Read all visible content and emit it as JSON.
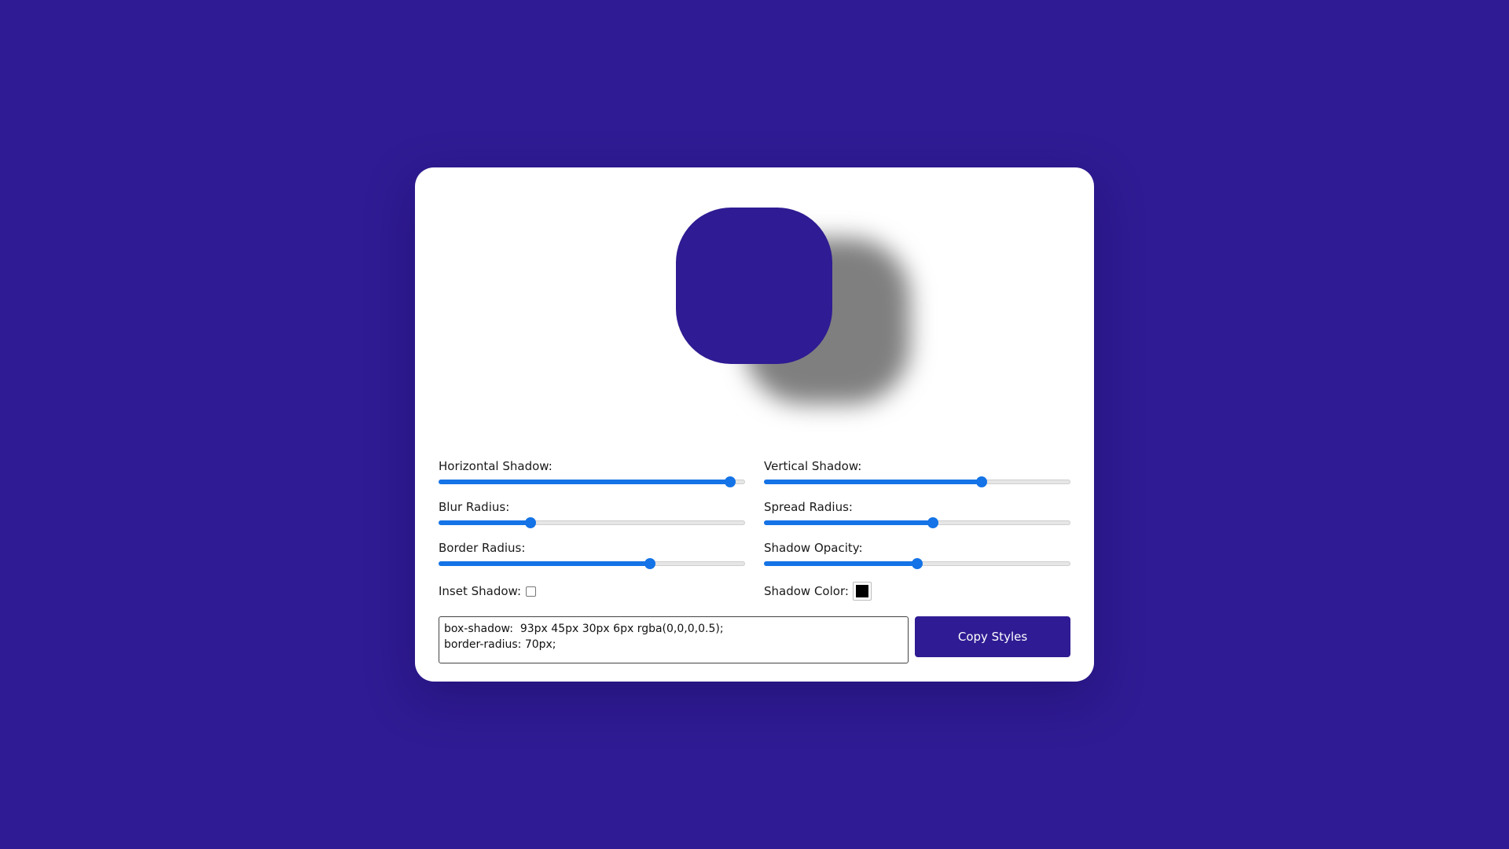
{
  "colors": {
    "background": "#2f1b93",
    "card": "#ffffff",
    "accent": "#1473e6",
    "button": "#2f1b93",
    "shadow_color": "#000000"
  },
  "controls": {
    "horizontal_shadow": {
      "label": "Horizontal Shadow:",
      "percent": 95
    },
    "vertical_shadow": {
      "label": "Vertical Shadow:",
      "percent": 71
    },
    "blur_radius": {
      "label": "Blur Radius:",
      "percent": 30
    },
    "spread_radius": {
      "label": "Spread Radius:",
      "percent": 55
    },
    "border_radius": {
      "label": "Border Radius:",
      "percent": 69
    },
    "shadow_opacity": {
      "label": "Shadow Opacity:",
      "percent": 50
    },
    "inset_shadow": {
      "label": "Inset Shadow:",
      "checked": false
    },
    "shadow_color": {
      "label": "Shadow Color:",
      "value": "#000000"
    }
  },
  "output": {
    "code": "box-shadow:  93px 45px 30px 6px rgba(0,0,0,0.5);\nborder-radius: 70px;",
    "copy_label": "Copy Styles"
  }
}
